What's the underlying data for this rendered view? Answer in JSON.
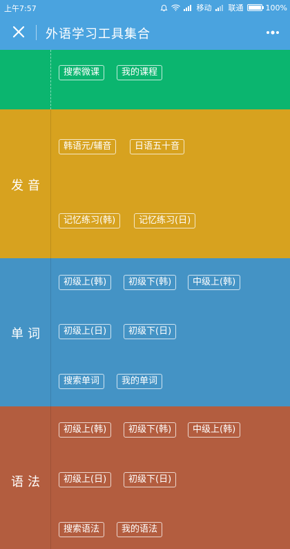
{
  "status_bar": {
    "time": "上午7:57",
    "carrier1": "移动",
    "carrier2": "联通",
    "battery": "100%"
  },
  "title_bar": {
    "title": "外语学习工具集合"
  },
  "top_section": {
    "tags": [
      "搜索微课",
      "我的课程"
    ]
  },
  "pronunciation": {
    "label": "发音",
    "tags": [
      "韩语元/辅音",
      "日语五十音",
      "记忆练习(韩)",
      "记忆练习(日)"
    ]
  },
  "vocabulary": {
    "label": "单词",
    "tags": [
      "初级上(韩)",
      "初级下(韩)",
      "中级上(韩)",
      "初级上(日)",
      "初级下(日)",
      "搜索单词",
      "我的单词"
    ]
  },
  "grammar": {
    "label": "语法",
    "tags": [
      "初级上(韩)",
      "初级下(韩)",
      "中级上(韩)",
      "初级上(日)",
      "初级下(日)",
      "搜索语法",
      "我的语法"
    ]
  },
  "colors": {
    "header": "#4aa3df",
    "top": "#0bb56f",
    "pronunciation": "#d7a21f",
    "vocabulary": "#4493c5",
    "grammar": "#b35d3f"
  }
}
